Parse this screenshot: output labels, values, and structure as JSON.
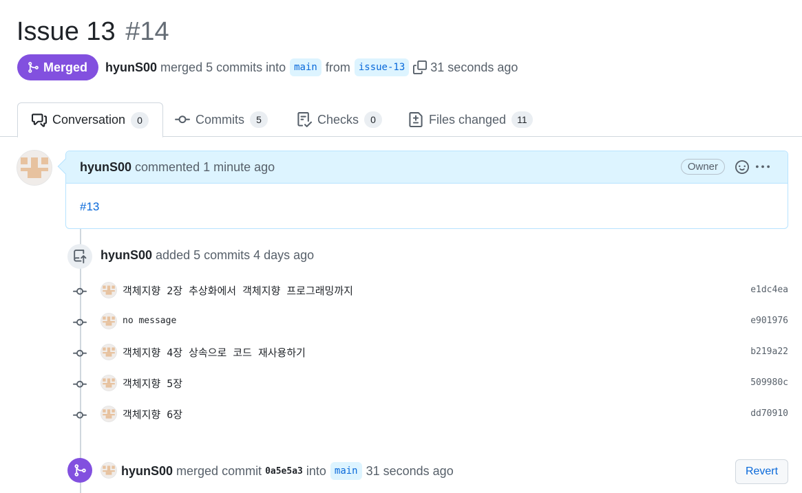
{
  "pr": {
    "title": "Issue 13",
    "number": "#14",
    "state": "Merged",
    "author": "hyunS00",
    "action_text": "merged 5 commits into",
    "base_branch": "main",
    "from_text": "from",
    "head_branch": "issue-13",
    "time": "31 seconds ago"
  },
  "tabs": [
    {
      "label": "Conversation",
      "count": "0",
      "icon": "comment-discussion-icon"
    },
    {
      "label": "Commits",
      "count": "5",
      "icon": "git-commit-icon"
    },
    {
      "label": "Checks",
      "count": "0",
      "icon": "checklist-icon"
    },
    {
      "label": "Files changed",
      "count": "11",
      "icon": "file-diff-icon"
    }
  ],
  "comment": {
    "author": "hyunS00",
    "action": "commented 1 minute ago",
    "role": "Owner",
    "body_link": "#13"
  },
  "commits_event": {
    "author": "hyunS00",
    "text": "added 5 commits 4 days ago"
  },
  "commits": [
    {
      "message": "객체지향 2장 추상화에서 객체지향 프로그래밍까지",
      "sha": "e1dc4ea"
    },
    {
      "message": "no message",
      "sha": "e901976"
    },
    {
      "message": "객체지향 4장 상속으로 코드 재사용하기",
      "sha": "b219a22"
    },
    {
      "message": "객체지향 5장",
      "sha": "509980c"
    },
    {
      "message": "객체지향 6장",
      "sha": "dd70910"
    }
  ],
  "merge_event": {
    "author": "hyunS00",
    "text_before": "merged commit",
    "sha": "0a5e5a3",
    "text_into": "into",
    "branch": "main",
    "time": "31 seconds ago",
    "revert_label": "Revert"
  },
  "colors": {
    "merged": "#8250df",
    "link": "#0969da",
    "branch_bg": "#ddf4ff",
    "comment_header_bg": "#ddf4ff"
  }
}
